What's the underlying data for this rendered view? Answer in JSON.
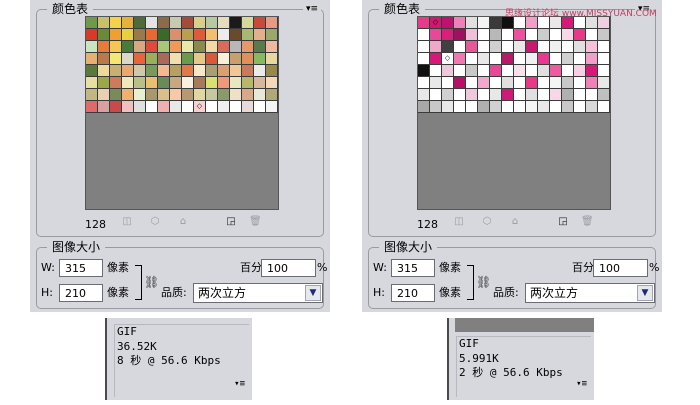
{
  "panels": [
    {
      "title": "颜色表",
      "menu_icon": "panel-menu-icon",
      "color_count": "128",
      "swatch_rows": [
        [
          "#6f9a4c",
          "#c8c06a",
          "#f6d24a",
          "#e8b23a",
          "#4e6c3a",
          "#e4e4e4",
          "#8a6b4a",
          "#c9c9b0",
          "#a84a3a",
          "#d9cf8a",
          "#b8c8a0",
          "#e8dcc0",
          "#1a1a1a",
          "#d8d898",
          "#c94a3a",
          "#e99a84"
        ],
        [
          "#d83a2a",
          "#6a8a3a",
          "#f0a030",
          "#e8d040",
          "#9a7a4a",
          "#e86a30",
          "#3a6a2a",
          "#dc8f6a",
          "#b9a050",
          "#e05a3a",
          "#f0c070",
          "#ececec",
          "#6a4a2a",
          "#a8b870",
          "#e4b08a",
          "#9aa86a"
        ],
        [
          "#c9e4c0",
          "#e87a3a",
          "#f4c850",
          "#4a7a3a",
          "#d8a880",
          "#e04a3a",
          "#a8c878",
          "#f09a5a",
          "#e8e8a8",
          "#8a8a4a",
          "#f4d8a8",
          "#da6a5a",
          "#b8b8b8",
          "#e89868",
          "#5a7a4a",
          "#f0b8a0"
        ],
        [
          "#e8b070",
          "#b87a4a",
          "#f4e870",
          "#dcd8c8",
          "#e8643a",
          "#98b05a",
          "#a86a5a",
          "#f0e0b0",
          "#6a9a4a",
          "#e8c888",
          "#d85a3a",
          "#f8f0d8",
          "#c8a070",
          "#e0905a",
          "#8ab860",
          "#e8d8a0"
        ],
        [
          "#5a7a3a",
          "#f0d898",
          "#c8b070",
          "#e8a870",
          "#d0c8a8",
          "#7a9a5a",
          "#f4b890",
          "#b8a060",
          "#e07848",
          "#f8e8c8",
          "#a8a070",
          "#dca070",
          "#f0c898",
          "#c87a5a",
          "#eaeaea",
          "#98884a"
        ],
        [
          "#e8e0a0",
          "#9aa84a",
          "#d07a5a",
          "#f0e8b8",
          "#b8c088",
          "#e8c070",
          "#6a8a5a",
          "#c8a880",
          "#f8f0e0",
          "#a87a5a",
          "#dce070",
          "#f09878",
          "#e8e8c0",
          "#b8b868",
          "#d8b898",
          "#f4d8b8"
        ],
        [
          "#c0b880",
          "#e8d0b0",
          "#7a8a5a",
          "#f0b070",
          "#e8f0d0",
          "#a8986a",
          "#d8c088",
          "#f8c8a8",
          "#b89870",
          "#e0d8a0",
          "#c8c8a0",
          "#8a9a6a",
          "#f0e0c8",
          "#d8a888",
          "#e8e8d8",
          "#b0a878"
        ],
        [
          "#e06a6a",
          "#d8a0a0",
          "#c84a4a",
          "#f0c0c0",
          "#e0e0e0",
          "#ffffff",
          "#f0b0b0",
          "#e8e8e8",
          "#ffffff",
          "#f8d0d0",
          "#ffffff",
          "#f0f0f0",
          "#ffffff",
          "#e8d8d8",
          "#ffffff",
          "#f4f4f4"
        ]
      ],
      "swatch_marker": {
        "row": 7,
        "col": 9,
        "glyph": "◇"
      },
      "tool_icons": [
        "snap-to-web-icon",
        "web-safe-icon",
        "lock-color-icon",
        "transparent-icon",
        "new-color-icon",
        "trash-icon"
      ],
      "size_title": "图像大小",
      "width_label": "W:",
      "width_value": "315",
      "height_label": "H:",
      "height_value": "210",
      "unit_width": "像素",
      "unit_height": "像素",
      "percent_label": "百分比:",
      "percent_value": "100",
      "percent_sign": "%",
      "quality_label": "品质:",
      "quality_value": "两次立方",
      "info": {
        "format": "GIF",
        "size": "36.52K",
        "speed": "8 秒 @ 56.6 Kbps",
        "menu_glyph": "▾≡"
      }
    },
    {
      "title": "颜色表",
      "menu_icon": "panel-menu-icon",
      "color_count": "128",
      "swatch_rows": [
        [
          "#e83a8a",
          "#d01870",
          "#c01070",
          "#f080b8",
          "#e0e0e0",
          "#f4f4f4",
          "#3a3a3a",
          "#101010",
          "#ffffff",
          "#f0a0c8",
          "#ffffff",
          "#e8e8e8",
          "#d81878",
          "#ffffff",
          "#e0e0e0",
          "#f0d0e0"
        ],
        [
          "#ffffff",
          "#e84898",
          "#d8207a",
          "#a01060",
          "#f0c0d8",
          "#ffffff",
          "#b8b8b8",
          "#ffffff",
          "#f050a0",
          "#ffffff",
          "#cccccc",
          "#ffffff",
          "#f8d8e8",
          "#e83888",
          "#ffffff",
          "#c8c8c8"
        ],
        [
          "#ffffff",
          "#f0a8c8",
          "#404040",
          "#ffffff",
          "#e85898",
          "#ffffff",
          "#d0d0d0",
          "#ffffff",
          "#e8e8e8",
          "#c81870",
          "#ffffff",
          "#f0f0f0",
          "#ffffff",
          "#e0e0e0",
          "#f8c0d8",
          "#ffffff"
        ],
        [
          "#ffffff",
          "#d81878",
          "#ffffff",
          "#f078b0",
          "#ffffff",
          "#e8e8e8",
          "#ffffff",
          "#b81868",
          "#ffffff",
          "#f0f0f0",
          "#e83890",
          "#ffffff",
          "#d0d0d0",
          "#ffffff",
          "#f0a0c8",
          "#ffffff"
        ],
        [
          "#101010",
          "#ffffff",
          "#f0c8dc",
          "#ffffff",
          "#c8c8c8",
          "#ffffff",
          "#e84898",
          "#ffffff",
          "#f8e0ec",
          "#ffffff",
          "#e0e0e0",
          "#f05aa0",
          "#ffffff",
          "#f8d0e4",
          "#d81878",
          "#ffffff"
        ],
        [
          "#ffffff",
          "#e8e8e8",
          "#ffffff",
          "#b81068",
          "#ffffff",
          "#f0a8cc",
          "#ffffff",
          "#e0e0e0",
          "#ffffff",
          "#e83888",
          "#ffffff",
          "#f4f4f4",
          "#c8c8c8",
          "#ffffff",
          "#f080b8",
          "#e8e8e8"
        ],
        [
          "#e8e8e8",
          "#ffffff",
          "#d0d0d0",
          "#ffffff",
          "#f0c8dc",
          "#ffffff",
          "#e8e8e8",
          "#d01878",
          "#ffffff",
          "#e0e0e0",
          "#ffffff",
          "#f8d8e8",
          "#b0b0b0",
          "#ffffff",
          "#ffffff",
          "#c0c0c0"
        ],
        [
          "#a8a8a8",
          "#c8c8c8",
          "#e8e8e8",
          "#ffffff",
          "#ffffff",
          "#b0b0b0",
          "#d0d0d0",
          "#ffffff",
          "#ffffff",
          "#f4f4f4",
          "#e8e8e8",
          "#ffffff",
          "#c8c8c8",
          "#ffffff",
          "#d8d8d8",
          "#ffffff"
        ]
      ],
      "swatch_marker": {
        "row": 0,
        "col": 1,
        "glyph": "◇"
      },
      "swatch_marker2": {
        "row": 3,
        "col": 2,
        "glyph": "◇"
      },
      "tool_icons": [
        "snap-to-web-icon",
        "web-safe-icon",
        "lock-color-icon",
        "transparent-icon",
        "new-color-icon",
        "trash-icon"
      ],
      "size_title": "图像大小",
      "width_label": "W:",
      "width_value": "315",
      "height_label": "H:",
      "height_value": "210",
      "unit_width": "像素",
      "unit_height": "像素",
      "percent_label": "百分比:",
      "percent_value": "100",
      "percent_sign": "%",
      "quality_label": "品质:",
      "quality_value": "两次立方",
      "info": {
        "format": "GIF",
        "size": "5.991K",
        "speed": "2 秒 @ 56.6 Kbps",
        "menu_glyph": "▾≡"
      }
    }
  ],
  "watermark": "思缘设计论坛 www.MISSYUAN.COM"
}
